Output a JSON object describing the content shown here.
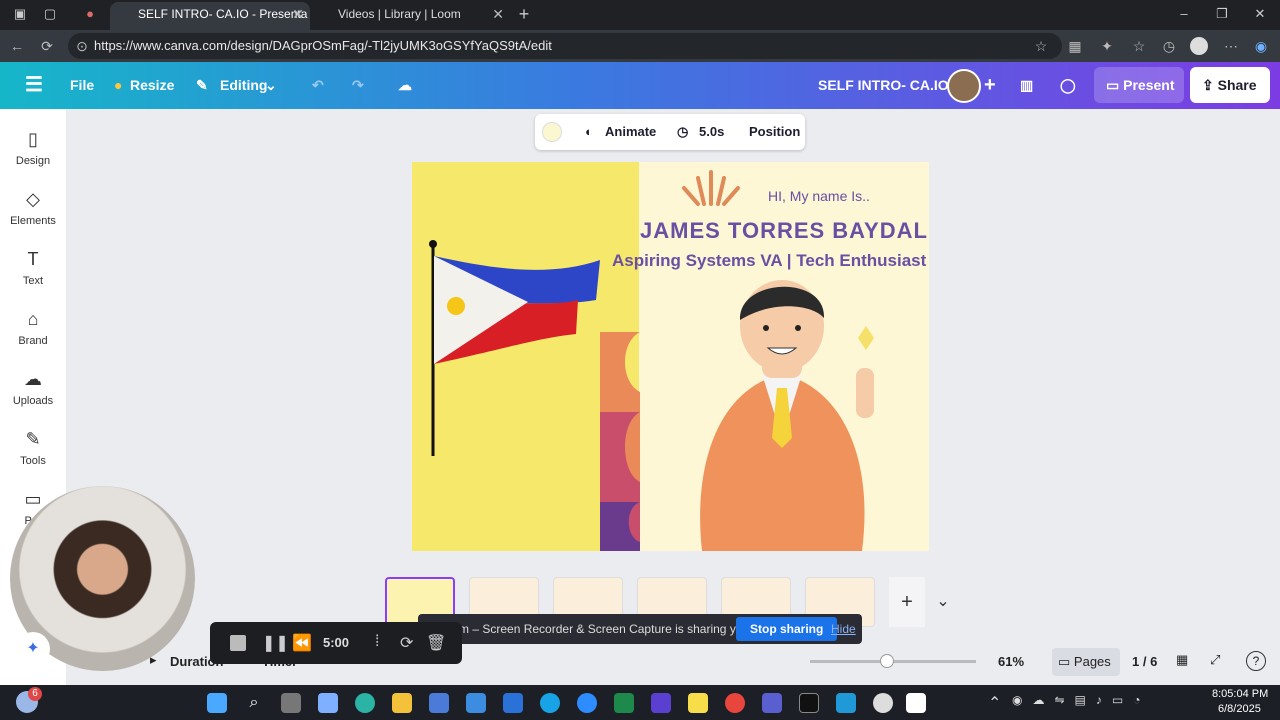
{
  "browser": {
    "tabs": [
      {
        "title": "SELF INTRO- CA.IO - Presenta",
        "active": true
      },
      {
        "title": "Videos | Library | Loom",
        "active": false
      }
    ],
    "url": "https://www.canva.com/design/DAGprOSmFag/-Tl2jyUMK3oGSYfYaQS9tA/edit"
  },
  "header": {
    "menu_icon": "hamburger-icon",
    "file": "File",
    "resize": "Resize",
    "editing": "Editing",
    "design_title": "SELF INTRO- CA.IO",
    "present": "Present",
    "share": "Share"
  },
  "sidebar": {
    "items": [
      {
        "label": "Design",
        "icon": "design-icon"
      },
      {
        "label": "Elements",
        "icon": "elements-icon"
      },
      {
        "label": "Text",
        "icon": "text-icon"
      },
      {
        "label": "Brand",
        "icon": "brand-icon"
      },
      {
        "label": "Uploads",
        "icon": "uploads-icon"
      },
      {
        "label": "Tools",
        "icon": "tools-icon"
      },
      {
        "label": "Pro",
        "icon": "projects-icon"
      }
    ]
  },
  "context_bar": {
    "animate": "Animate",
    "duration": "5.0s",
    "position": "Position"
  },
  "slide": {
    "greeting": "HI, My name Is..",
    "name": "JAMES TORRES BAYDAL",
    "tagline": "Aspiring Systems VA | Tech Enthusiast"
  },
  "bottom": {
    "duration": "Duration",
    "timer": "Timer",
    "zoom": "61%",
    "zoom_level": 0.61,
    "pages_label": "Pages",
    "page_counter": "1 / 6"
  },
  "loom": {
    "message": "Loom – Screen Recorder & Screen Capture is sharing your screen.",
    "stop": "Stop sharing",
    "hide": "Hide",
    "time": "5:00"
  },
  "taskbar": {
    "badge": "6",
    "time": "8:05:04 PM",
    "date": "6/8/2025"
  },
  "colors": {
    "accent": "#8b3dff",
    "slide_title": "#6a4fa3",
    "panel_yellow": "#f6e86a"
  }
}
